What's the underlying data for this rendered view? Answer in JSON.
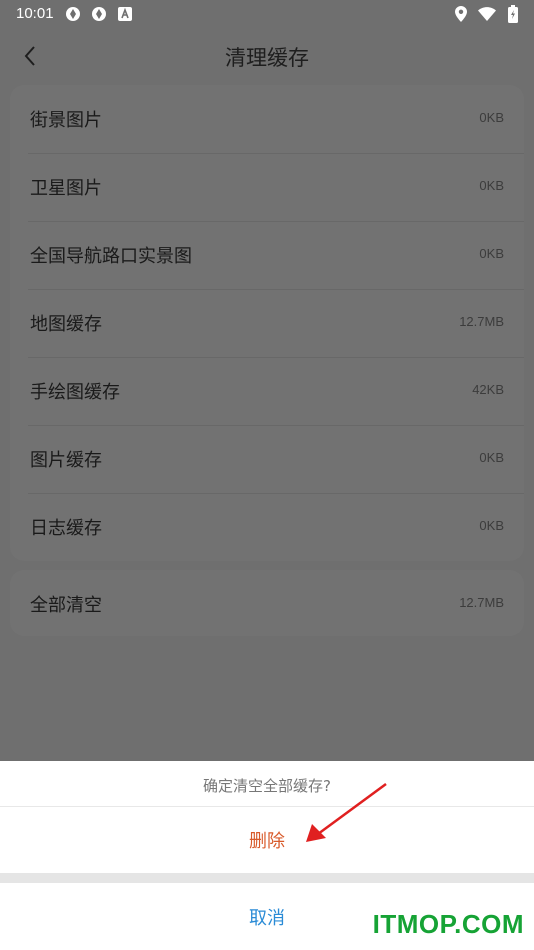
{
  "status_bar": {
    "time": "10:01",
    "left_icons": [
      "sync-icon",
      "sync-icon",
      "font-icon"
    ],
    "right_icons": [
      "location-icon",
      "wifi-icon",
      "battery-icon"
    ]
  },
  "header": {
    "back_icon": "chevron-left-icon",
    "title": "清理缓存"
  },
  "cache_items": [
    {
      "label": "街景图片",
      "size": "0KB"
    },
    {
      "label": "卫星图片",
      "size": "0KB"
    },
    {
      "label": "全国导航路口实景图",
      "size": "0KB"
    },
    {
      "label": "地图缓存",
      "size": "12.7MB"
    },
    {
      "label": "手绘图缓存",
      "size": "42KB"
    },
    {
      "label": "图片缓存",
      "size": "0KB"
    },
    {
      "label": "日志缓存",
      "size": "0KB"
    }
  ],
  "clear_all": {
    "label": "全部清空",
    "size": "12.7MB"
  },
  "dialog": {
    "title": "确定清空全部缓存?",
    "delete_label": "删除",
    "cancel_label": "取消"
  },
  "watermark": "ITMOP.COM",
  "colors": {
    "overlay": "#6f6f6f",
    "delete": "#d85a2a",
    "cancel": "#2a8bd6",
    "arrow": "#e02020",
    "watermark": "#16a335"
  }
}
